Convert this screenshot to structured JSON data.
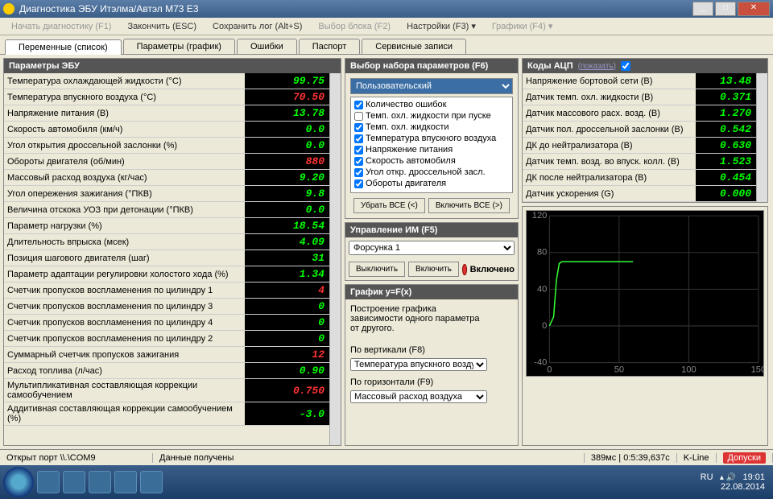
{
  "window": {
    "title": "Диагностика ЭБУ Итэлма/Автэл М73 E3"
  },
  "menu": {
    "start": "Начать диагностику (F1)",
    "end": "Закончить (ESC)",
    "savelog": "Сохранить лог (Alt+S)",
    "block": "Выбор блока (F2)",
    "settings": "Настройки (F3) ▾",
    "graphs": "Графики (F4) ▾"
  },
  "tabs": {
    "t1": "Переменные (список)",
    "t2": "Параметры (график)",
    "t3": "Ошибки",
    "t4": "Паспорт",
    "t5": "Сервисные записи"
  },
  "ecu": {
    "title": "Параметры ЭБУ",
    "rows": [
      {
        "label": "Температура охлаждающей жидкости (°С)",
        "value": "99.75",
        "c": "g"
      },
      {
        "label": "Температура впускного воздуха (°С)",
        "value": "70.50",
        "c": "r"
      },
      {
        "label": "Напряжение питания (В)",
        "value": "13.78",
        "c": "g"
      },
      {
        "label": "Скорость автомобиля (км/ч)",
        "value": "0.0",
        "c": "g"
      },
      {
        "label": "Угол открытия дроссельной заслонки (%)",
        "value": "0.0",
        "c": "g"
      },
      {
        "label": "Обороты двигателя (об/мин)",
        "value": "880",
        "c": "r"
      },
      {
        "label": "Массовый расход воздуха (кг/час)",
        "value": "9.20",
        "c": "g"
      },
      {
        "label": "Угол опережения зажигания (°ПКВ)",
        "value": "9.8",
        "c": "g"
      },
      {
        "label": "Величина отскока УОЗ при детонации (°ПКВ)",
        "value": "0.0",
        "c": "g"
      },
      {
        "label": "Параметр нагрузки (%)",
        "value": "18.54",
        "c": "g"
      },
      {
        "label": "Длительность впрыска (мсек)",
        "value": "4.09",
        "c": "g"
      },
      {
        "label": "Позиция шагового двигателя (шаг)",
        "value": "31",
        "c": "g"
      },
      {
        "label": "Параметр адаптации регулировки холостого хода (%)",
        "value": "1.34",
        "c": "g"
      },
      {
        "label": "Счетчик пропусков воспламенения по цилиндру 1",
        "value": "4",
        "c": "r"
      },
      {
        "label": "Счетчик пропусков воспламенения по цилиндру 3",
        "value": "0",
        "c": "g"
      },
      {
        "label": "Счетчик пропусков воспламенения по цилиндру 4",
        "value": "0",
        "c": "g"
      },
      {
        "label": "Счетчик пропусков воспламенения по цилиндру 2",
        "value": "0",
        "c": "g"
      },
      {
        "label": "Суммарный счетчик пропусков зажигания",
        "value": "12",
        "c": "r"
      },
      {
        "label": "Расход топлива (л/час)",
        "value": "0.90",
        "c": "g"
      },
      {
        "label": "Мультипликативная составляющая коррекции самообучением",
        "value": "0.750",
        "c": "r"
      },
      {
        "label": "Аддитивная составляющая коррекции самообучением (%)",
        "value": "-3.0",
        "c": "g"
      }
    ]
  },
  "paramset": {
    "title": "Выбор набора параметров (F6)",
    "selected": "Пользовательский",
    "checks": [
      {
        "label": "Количество ошибок",
        "on": true
      },
      {
        "label": "Темп. охл. жидкости при пуске",
        "on": false
      },
      {
        "label": "Темп. охл. жидкости",
        "on": true
      },
      {
        "label": "Температура впускного воздуха",
        "on": true
      },
      {
        "label": "Напряжение питания",
        "on": true
      },
      {
        "label": "Скорость автомобиля",
        "on": true
      },
      {
        "label": "Угол откр. дроссельной засл.",
        "on": true
      },
      {
        "label": "Обороты двигателя",
        "on": true
      }
    ],
    "btn_remove": "Убрать ВСЕ (<)",
    "btn_add": "Включить ВСЕ (>)"
  },
  "adc": {
    "title": "Коды АЦП",
    "show": "(показать)",
    "rows": [
      {
        "label": "Напряжение бортовой сети (В)",
        "value": "13.48"
      },
      {
        "label": "Датчик темп. охл. жидкости (В)",
        "value": "0.371"
      },
      {
        "label": "Датчик массового расх. возд. (В)",
        "value": "1.270"
      },
      {
        "label": "Датчик пол. дроссельной заслонки (В)",
        "value": "0.542"
      },
      {
        "label": "ДК до нейтрализатора (В)",
        "value": "0.630"
      },
      {
        "label": "Датчик темп. возд. во впуск. колл. (В)",
        "value": "1.523"
      },
      {
        "label": "ДК после нейтрализатора (В)",
        "value": "0.454"
      },
      {
        "label": "Датчик ускорения (G)",
        "value": "0.000"
      }
    ]
  },
  "im": {
    "title": "Управление ИМ (F5)",
    "selected": "Форсунка 1",
    "btn_off": "Выключить",
    "btn_on": "Включить",
    "status": "Включено"
  },
  "graph": {
    "title": "График y=F(x)",
    "desc": "Построение графика зависимости одного параметра от другого.",
    "ylabel": "По вертикали (F8)",
    "ysel": "Температура впускного воздуха",
    "xlabel": "По горизонтали (F9)",
    "xsel": "Массовый расход воздуха"
  },
  "chart_data": {
    "type": "line",
    "title": "",
    "xlabel": "",
    "ylabel": "",
    "xlim": [
      0,
      150
    ],
    "ylim": [
      -40,
      120
    ],
    "x_ticks": [
      0,
      50,
      100,
      150
    ],
    "y_ticks": [
      -40,
      0,
      40,
      80,
      120
    ],
    "series": [
      {
        "name": "Температура впускного воздуха",
        "color": "#3f3",
        "x": [
          0,
          3,
          5,
          7,
          9,
          11,
          60
        ],
        "y": [
          0,
          10,
          50,
          68,
          70,
          70,
          70
        ]
      }
    ]
  },
  "statusbar": {
    "port": "Открыт порт \\\\.\\COM9",
    "data": "Данные получены",
    "timing": "389мс | 0:5:39,637с",
    "kline": "K-Line",
    "badge": "Допуски"
  },
  "tray": {
    "lang": "RU",
    "time": "19:01",
    "date": "22.08.2014"
  }
}
